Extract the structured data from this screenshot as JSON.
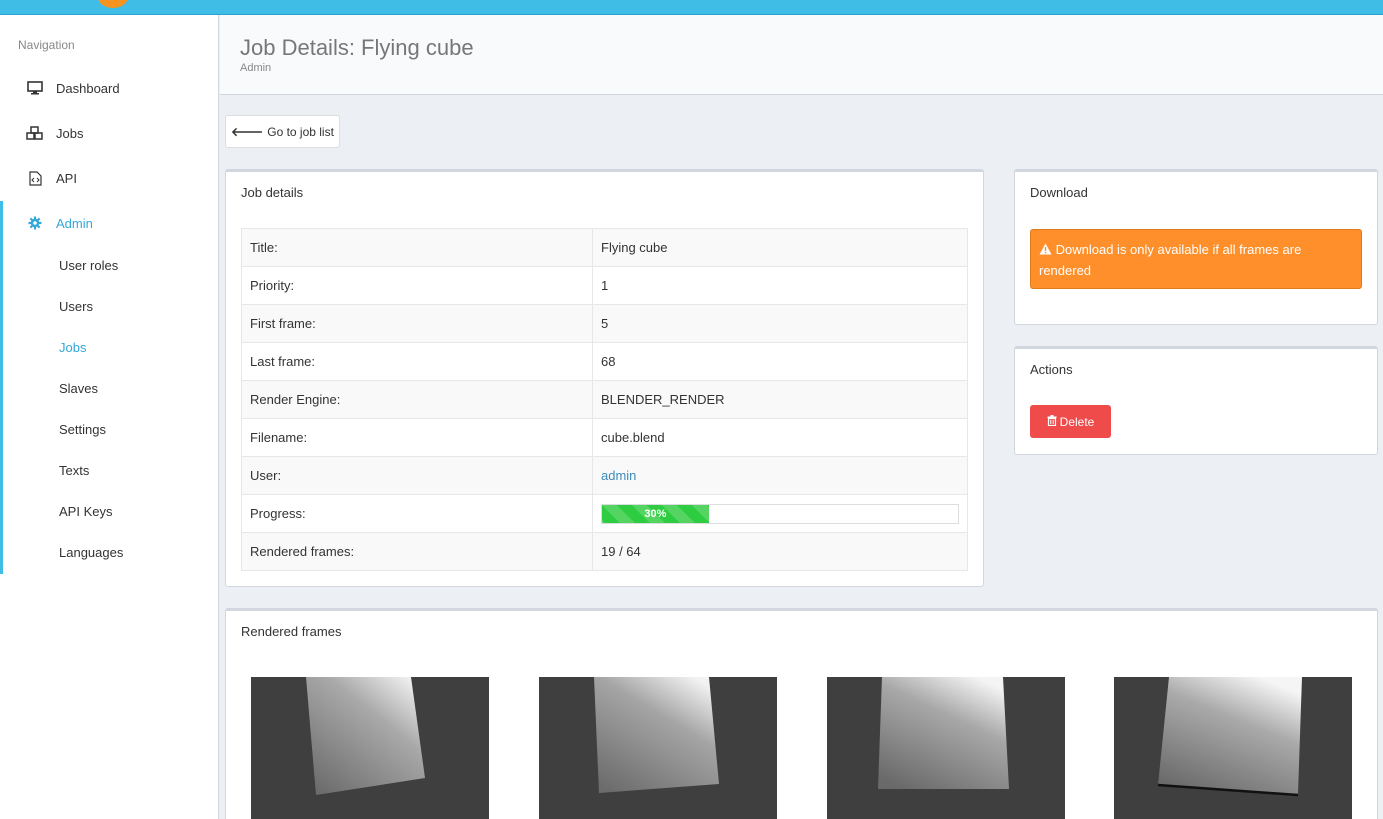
{
  "colors": {
    "accent": "#3fbde6",
    "alert": "#ff8f2b",
    "danger": "#ef4b4b",
    "progress": "#2ecc40"
  },
  "sidebar": {
    "header": "Navigation",
    "items": [
      {
        "label": "Dashboard",
        "icon": "monitor-icon"
      },
      {
        "label": "Jobs",
        "icon": "cubes-icon"
      },
      {
        "label": "API",
        "icon": "file-code-icon"
      },
      {
        "label": "Admin",
        "icon": "gear-icon"
      }
    ],
    "admin_items": [
      {
        "label": "User roles"
      },
      {
        "label": "Users"
      },
      {
        "label": "Jobs"
      },
      {
        "label": "Slaves"
      },
      {
        "label": "Settings"
      },
      {
        "label": "Texts"
      },
      {
        "label": "API Keys"
      },
      {
        "label": "Languages"
      }
    ]
  },
  "header": {
    "title": "Job Details: Flying cube",
    "breadcrumb": "Admin"
  },
  "back_button": {
    "label": "Go to job list",
    "icon": "arrow-left-icon"
  },
  "job_details": {
    "title": "Job details",
    "rows": [
      {
        "key": "Title:",
        "value": "Flying cube"
      },
      {
        "key": "Priority:",
        "value": "1"
      },
      {
        "key": "First frame:",
        "value": "5"
      },
      {
        "key": "Last frame:",
        "value": "68"
      },
      {
        "key": "Render Engine:",
        "value": "BLENDER_RENDER"
      },
      {
        "key": "Filename:",
        "value": "cube.blend"
      },
      {
        "key": "User:",
        "value": "admin"
      },
      {
        "key": "Progress:",
        "value": "30%",
        "progress": 0.3
      },
      {
        "key": "Rendered frames:",
        "value": "19 / 64"
      }
    ]
  },
  "download": {
    "title": "Download",
    "alert_icon": "warning-icon",
    "alert_text": "Download is only available if all frames are rendered"
  },
  "actions": {
    "title": "Actions",
    "delete_label": "Delete",
    "delete_icon": "trash-icon"
  },
  "rendered_frames": {
    "title": "Rendered frames",
    "frames": [
      "frame-1",
      "frame-2",
      "frame-3",
      "frame-4"
    ]
  }
}
